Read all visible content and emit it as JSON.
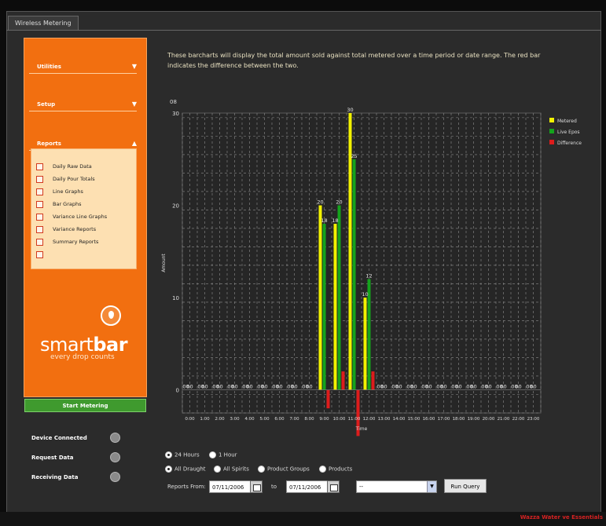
{
  "window": {
    "tab_label": "Wireless Metering"
  },
  "sidebar": {
    "sections": [
      {
        "label": "Utilities",
        "chevron": "▼"
      },
      {
        "label": "Setup",
        "chevron": "▼"
      },
      {
        "label": "Reports",
        "chevron": "▲"
      }
    ],
    "report_items": [
      "Daily Raw Data",
      "Daily Pour Totals",
      "Line Graphs",
      "Bar Graphs",
      "Variance Line Graphs",
      "Variance Reports",
      "Summary Reports",
      ""
    ],
    "brand": {
      "part1": "smart",
      "part2": "bar",
      "tagline": "every drop counts"
    },
    "start_button": "Start Metering",
    "status": [
      {
        "label": "Device Connected"
      },
      {
        "label": "Request Data"
      },
      {
        "label": "Receiving Data"
      }
    ]
  },
  "main": {
    "description": "These barcharts will display the total amount sold against total metered over a time period or date range. The red bar indicates the difference between the two.",
    "chart_title": "08",
    "time_options": [
      {
        "label": "24 Hours",
        "selected": true
      },
      {
        "label": "1 Hour",
        "selected": false
      }
    ],
    "product_options": [
      {
        "label": "All Draught",
        "selected": true
      },
      {
        "label": "All Spirits",
        "selected": false
      },
      {
        "label": "Product Groups",
        "selected": false
      },
      {
        "label": "Products",
        "selected": false
      }
    ],
    "reports_from_label": "Reports From:",
    "date_from": "07/11/2006",
    "to_label": "to",
    "date_to": "07/11/2006",
    "product_select": "--",
    "run_query": "Run Query"
  },
  "footer": {
    "text": "Wazza Water ve Essentials"
  },
  "chart_data": {
    "type": "bar",
    "title": "",
    "xlabel": "Time",
    "ylabel": "Amount",
    "ylim": [
      -2.5,
      30
    ],
    "yticks": [
      0,
      10,
      20,
      30
    ],
    "grid": true,
    "legend_position": "right",
    "categories": [
      "0:00",
      "1:00",
      "2:00",
      "3:00",
      "4:00",
      "5:00",
      "6:00",
      "7:00",
      "8:00",
      "9:00",
      "10:00",
      "11:00",
      "12:00",
      "13:00",
      "14:00",
      "15:00",
      "16:00",
      "17:00",
      "18:00",
      "19:00",
      "20:00",
      "21:00",
      "22:00",
      "23:00"
    ],
    "series": [
      {
        "name": "Metered",
        "color": "#f2f200",
        "values": [
          0,
          0,
          0,
          0,
          0,
          0,
          0,
          0,
          0,
          20,
          18,
          30,
          10,
          0,
          0,
          0,
          0,
          0,
          0,
          0,
          0,
          0,
          0,
          0
        ],
        "labels": [
          "00",
          "00",
          "00",
          "00",
          "00",
          "00",
          "00",
          "00",
          "00",
          "20",
          "18",
          "30",
          "10",
          "00",
          "00",
          "00",
          "00",
          "00",
          "00",
          "00",
          "00",
          "00",
          "00",
          "00"
        ]
      },
      {
        "name": "Live Epos",
        "color": "#14a41c",
        "values": [
          0,
          0,
          0,
          0,
          0,
          0,
          0,
          0,
          0,
          18,
          20,
          25,
          12,
          0,
          0,
          0,
          0,
          0,
          0,
          0,
          0,
          0,
          0,
          0
        ],
        "labels": [
          "00",
          "00",
          "00",
          "00",
          "00",
          "00",
          "00",
          "00",
          "00",
          "18",
          "20",
          "25",
          "12",
          "00",
          "00",
          "00",
          "00",
          "00",
          "00",
          "00",
          "00",
          "00",
          "00",
          "00"
        ]
      },
      {
        "name": "Difference",
        "color": "#dd1c1c",
        "values": [
          0,
          0,
          0,
          0,
          0,
          0,
          0,
          0,
          0,
          -2,
          2,
          -5,
          2,
          0,
          0,
          0,
          0,
          0,
          0,
          0,
          0,
          0,
          0,
          0
        ]
      }
    ]
  }
}
